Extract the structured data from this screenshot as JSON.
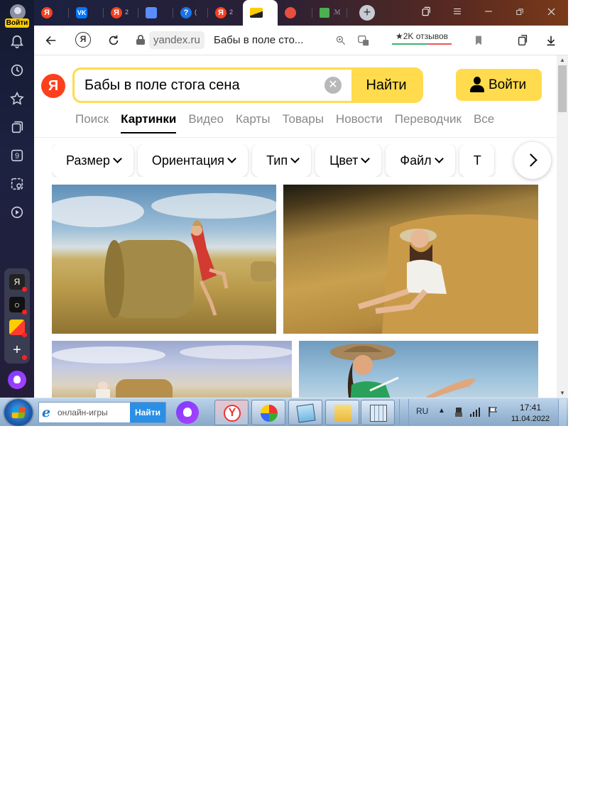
{
  "sidebar": {
    "login_label": "Войти",
    "icons": [
      "bell-icon",
      "history-icon",
      "star-icon",
      "collections-icon",
      "counter-icon",
      "screenshot-icon",
      "video-play-icon"
    ],
    "counter_value": "9",
    "apps": [
      {
        "name": "yandex-app",
        "glyph": "Я"
      },
      {
        "name": "messenger-app",
        "glyph": "○"
      },
      {
        "name": "mail-app",
        "glyph": ""
      },
      {
        "name": "add-app",
        "glyph": "+"
      }
    ]
  },
  "tabs": [
    {
      "fav": "Я",
      "color": "#fc3f1d",
      "mini": ""
    },
    {
      "fav": "VK",
      "color": "#0077ff",
      "mini": ""
    },
    {
      "fav": "Я",
      "color": "#fc3f1d",
      "mini": "2"
    },
    {
      "fav": "",
      "color": "#5a8cff",
      "mini": ""
    },
    {
      "fav": "?",
      "color": "#1a73e8",
      "mini": "("
    },
    {
      "fav": "Я",
      "color": "#fc3f1d",
      "mini": "2"
    },
    {
      "fav": "",
      "color": "#ffcc00",
      "mini": ""
    },
    {
      "fav": "",
      "color": "#e84d3d",
      "mini": ""
    },
    {
      "fav": "",
      "color": "#4caf50",
      "mini": "ℳ"
    }
  ],
  "window_controls": [
    "tab-list-icon",
    "menu-icon",
    "minimize-icon",
    "restore-icon",
    "close-icon"
  ],
  "navbar": {
    "ya_button": "Я",
    "domain": "yandex.ru",
    "title": "Бабы в поле сто...",
    "reviews": "★2K отзывов"
  },
  "search": {
    "query": "Бабы в поле стога сена",
    "find_label": "Найти",
    "signin_label": "Войти",
    "logo": "Я"
  },
  "services": [
    "Поиск",
    "Картинки",
    "Видео",
    "Карты",
    "Товары",
    "Новости",
    "Переводчик",
    "Все"
  ],
  "active_service": "Картинки",
  "filters": [
    "Размер",
    "Ориентация",
    "Тип",
    "Цвет",
    "Файл",
    "Т"
  ],
  "taskbar": {
    "search_placeholder": "онлайн-игры",
    "search_button": "Найти",
    "lang": "RU",
    "time": "17:41",
    "date": "11.04.2022"
  },
  "colors": {
    "yandex_red": "#fc3f1d",
    "yandex_yellow": "#ffdb4d"
  }
}
